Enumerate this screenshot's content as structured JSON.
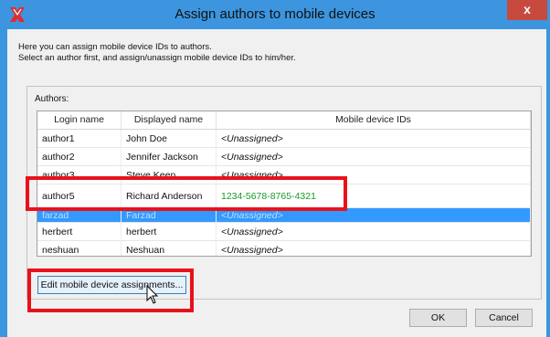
{
  "window": {
    "title": "Assign authors to mobile devices",
    "close_label": "x"
  },
  "intro": {
    "line1": "Here you can assign mobile device IDs to authors.",
    "line2": "Select an author first, and assign/unassign mobile device IDs to him/her."
  },
  "authors_group": {
    "label": "Authors:",
    "columns": [
      "Login name",
      "Displayed name",
      "Mobile device IDs"
    ],
    "rows": [
      {
        "login": "author1",
        "display": "John Doe",
        "devices": "<Unassigned>"
      },
      {
        "login": "author2",
        "display": "Jennifer Jackson",
        "devices": "<Unassigned>"
      },
      {
        "login": "author3",
        "display": "Steve Keen",
        "devices": "<Unassigned>"
      },
      {
        "login": "author5",
        "display": "Richard Anderson",
        "devices": "1234-5678-8765-4321"
      },
      {
        "login": "farzad",
        "display": "Farzad",
        "devices": "<Unassigned>"
      },
      {
        "login": "herbert",
        "display": "herbert",
        "devices": "<Unassigned>"
      },
      {
        "login": "neshuan",
        "display": "Neshuan",
        "devices": "<Unassigned>"
      }
    ]
  },
  "buttons": {
    "edit": "Edit mobile device assignments...",
    "ok": "OK",
    "cancel": "Cancel"
  },
  "colors": {
    "title_bar": "#3c95de",
    "selection": "#3399ff",
    "assigned_id": "#1a9a2a",
    "annotation_red": "#e8121b"
  }
}
